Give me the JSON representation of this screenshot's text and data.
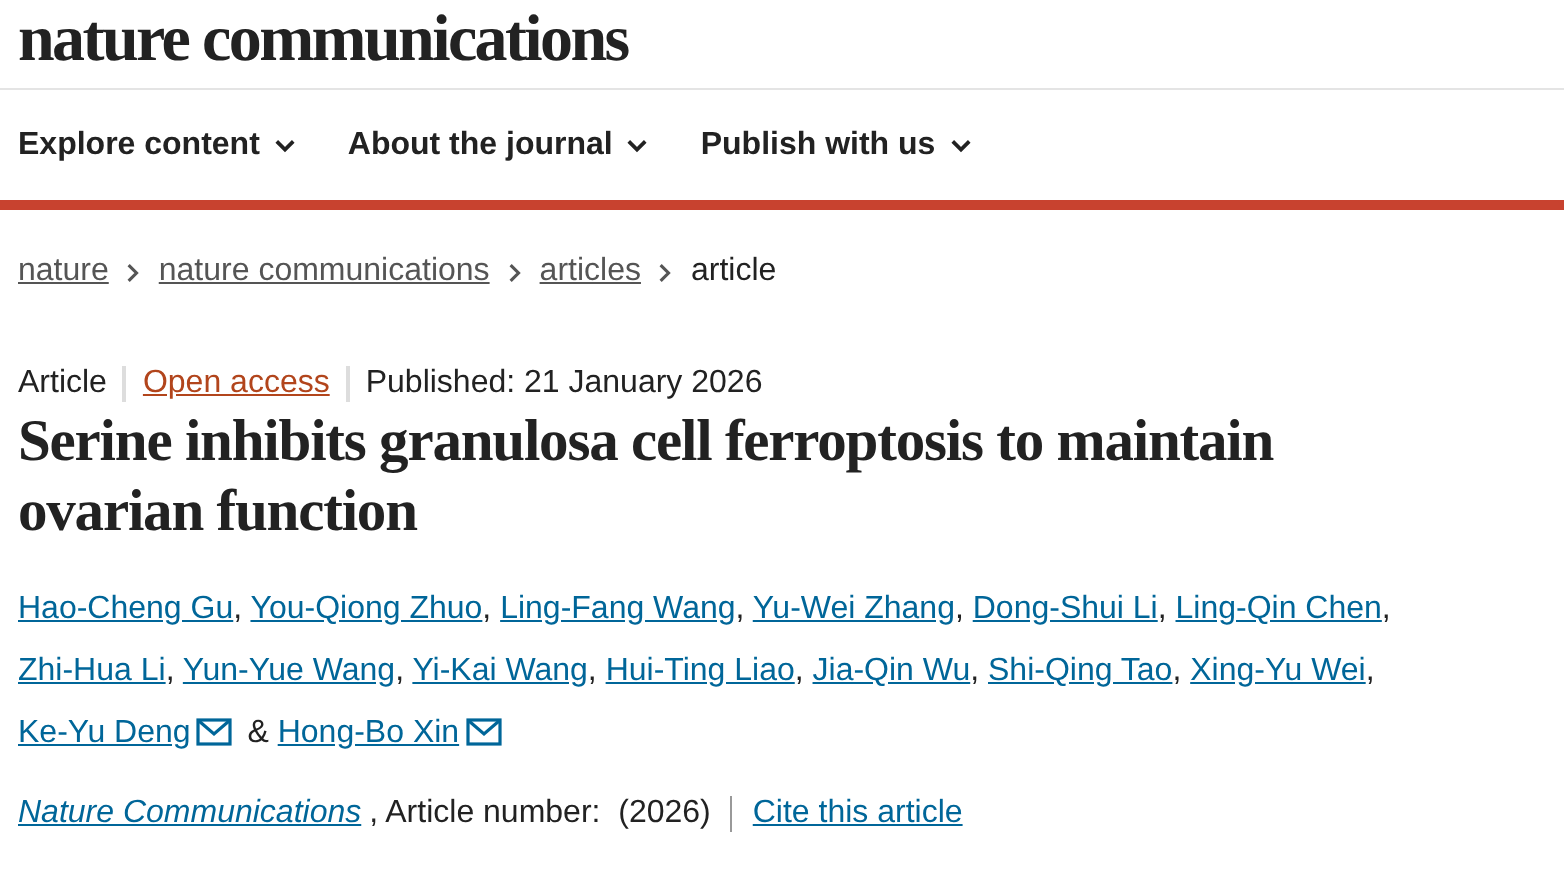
{
  "logo": "nature communications",
  "nav": [
    {
      "label": "Explore content"
    },
    {
      "label": "About the journal"
    },
    {
      "label": "Publish with us"
    }
  ],
  "breadcrumb": [
    {
      "label": "nature",
      "current": false
    },
    {
      "label": "nature communications",
      "current": false
    },
    {
      "label": "articles",
      "current": false
    },
    {
      "label": "article",
      "current": true
    }
  ],
  "meta": {
    "type": "Article",
    "access": "Open access",
    "published": "Published: 21 January 2026"
  },
  "title": "Serine inhibits granulosa cell ferroptosis to maintain ovarian function",
  "authors": {
    "delimiter": ",",
    "conjunction": "&",
    "items": [
      {
        "name": "Hao-Cheng Gu",
        "mail": false
      },
      {
        "name": "You-Qiong Zhuo",
        "mail": false
      },
      {
        "name": "Ling-Fang Wang",
        "mail": false
      },
      {
        "name": "Yu-Wei Zhang",
        "mail": false
      },
      {
        "name": "Dong-Shui Li",
        "mail": false
      },
      {
        "name": "Ling-Qin Chen",
        "mail": false
      },
      {
        "name": "Zhi-Hua Li",
        "mail": false
      },
      {
        "name": "Yun-Yue Wang",
        "mail": false
      },
      {
        "name": "Yi-Kai Wang",
        "mail": false
      },
      {
        "name": "Hui-Ting Liao",
        "mail": false
      },
      {
        "name": "Jia-Qin Wu",
        "mail": false
      },
      {
        "name": "Shi-Qing Tao",
        "mail": false
      },
      {
        "name": "Xing-Yu Wei",
        "mail": false
      },
      {
        "name": "Ke-Yu Deng",
        "mail": true
      },
      {
        "name": "Hong-Bo Xin",
        "mail": true
      }
    ]
  },
  "citation": {
    "journal": "Nature Communications",
    "number": ", Article number:  (2026)",
    "cite": "Cite this article"
  }
}
